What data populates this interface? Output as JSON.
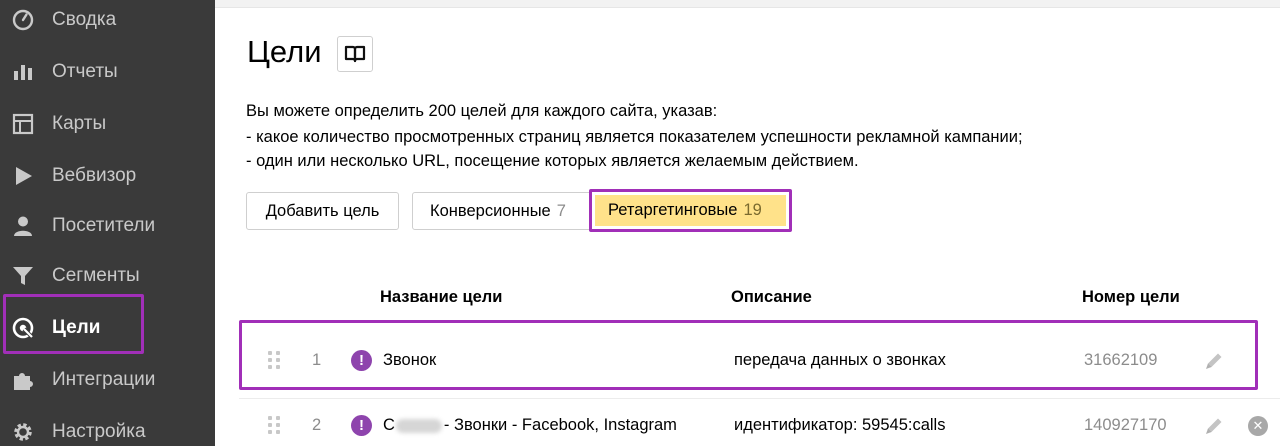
{
  "sidebar": {
    "items": [
      {
        "label": "Сводка",
        "icon": "gauge-icon"
      },
      {
        "label": "Отчеты",
        "icon": "bar-chart-icon"
      },
      {
        "label": "Карты",
        "icon": "map-layout-icon"
      },
      {
        "label": "Вебвизор",
        "icon": "play-icon"
      },
      {
        "label": "Посетители",
        "icon": "person-icon"
      },
      {
        "label": "Сегменты",
        "icon": "filter-icon"
      },
      {
        "label": "Цели",
        "icon": "target-icon",
        "active": true
      },
      {
        "label": "Интеграции",
        "icon": "puzzle-icon"
      },
      {
        "label": "Настройка",
        "icon": "gear-icon"
      }
    ]
  },
  "page": {
    "title": "Цели",
    "description": [
      "Вы можете определить 200 целей для каждого сайта, указав:",
      "-  какое количество просмотренных страниц является показателем успешности рекламной кампании;",
      "-  один или несколько URL, посещение которых является желаемым действием."
    ]
  },
  "toolbar": {
    "add_label": "Добавить цель",
    "tab_conversion_label": "Конверсионные",
    "tab_conversion_count": "7",
    "tab_retargeting_label": "Ретаргетинговые",
    "tab_retargeting_count": "19"
  },
  "table": {
    "headers": {
      "name": "Название цели",
      "description": "Описание",
      "number": "Номер цели"
    },
    "rows": [
      {
        "index": "1",
        "name": "Звонок",
        "name_prefix": "",
        "description": "передача данных о звонках",
        "number": "31662109"
      },
      {
        "index": "2",
        "name": "- Звонки - Facebook, Instagram",
        "name_prefix": "С",
        "description": "идентификатор: 59545:calls",
        "number": "140927170"
      }
    ]
  },
  "colors": {
    "sidebar_bg": "#3a3a3a",
    "highlight": "#a12fb8",
    "active_tab": "#ffe28a",
    "goal_icon": "#8e44ad"
  }
}
